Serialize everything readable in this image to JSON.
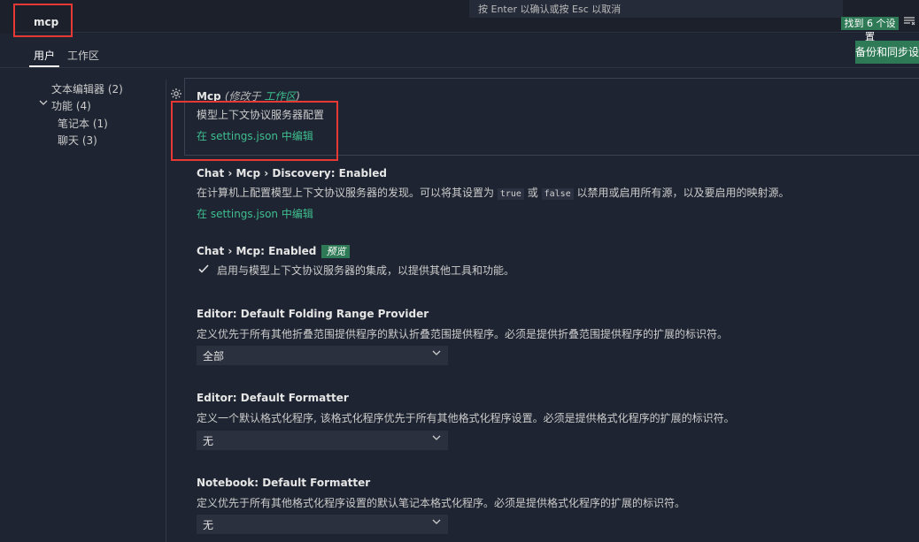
{
  "search": {
    "value": "mcp"
  },
  "hint": "按 Enter 以确认或按 Esc 以取消",
  "results_badge": "找到 6 个设置",
  "filter_icon": "filter-icon",
  "tabs": [
    {
      "label": "用户"
    },
    {
      "label": "工作区"
    }
  ],
  "backup_button": "备份和同步设置",
  "sidebar": {
    "items": [
      {
        "label": "文本编辑器",
        "count": "(2)"
      },
      {
        "label": "功能",
        "count": "(4)"
      },
      {
        "label": "笔记本",
        "count": "(1)"
      },
      {
        "label": "聊天",
        "count": "(3)"
      }
    ]
  },
  "settings": {
    "mcp": {
      "title": "Mcp",
      "modified_prefix": "(修改于 ",
      "modified_link": "工作区",
      "modified_suffix": ")",
      "desc": "模型上下文协议服务器配置",
      "link": "在 settings.json 中编辑"
    },
    "discovery": {
      "title": "Chat › Mcp › Discovery: Enabled",
      "desc_1": "在计算机上配置模型上下文协议服务器的发现。可以将其设置为",
      "code_true": "true",
      "desc_or": "或",
      "code_false": "false",
      "desc_2": "以禁用或启用所有源，以及要启用的映射源。",
      "link": "在 settings.json 中编辑"
    },
    "mcp_enabled": {
      "title": "Chat › Mcp: Enabled",
      "badge": "预览",
      "checkbox_label": "启用与模型上下文协议服务器的集成，以提供其他工具和功能。"
    },
    "folding": {
      "title": "Editor: Default Folding Range Provider",
      "desc": "定义优先于所有其他折叠范围提供程序的默认折叠范围提供程序。必须是提供折叠范围提供程序的扩展的标识符。",
      "value": "全部"
    },
    "formatter": {
      "title": "Editor: Default Formatter",
      "desc": "定义一个默认格式化程序, 该格式化程序优先于所有其他格式化程序设置。必须是提供格式化程序的扩展的标识符。",
      "value": "无"
    },
    "nb_formatter": {
      "title": "Notebook: Default Formatter",
      "desc": "定义优先于所有其他格式化程序设置的默认笔记本格式化程序。必须是提供格式化程序的扩展的标识符。",
      "value": "无"
    }
  },
  "colors": {
    "accent": "#2f7a56",
    "link": "#3fbf8f",
    "highlight": "#e53935",
    "background": "#1e2431"
  }
}
